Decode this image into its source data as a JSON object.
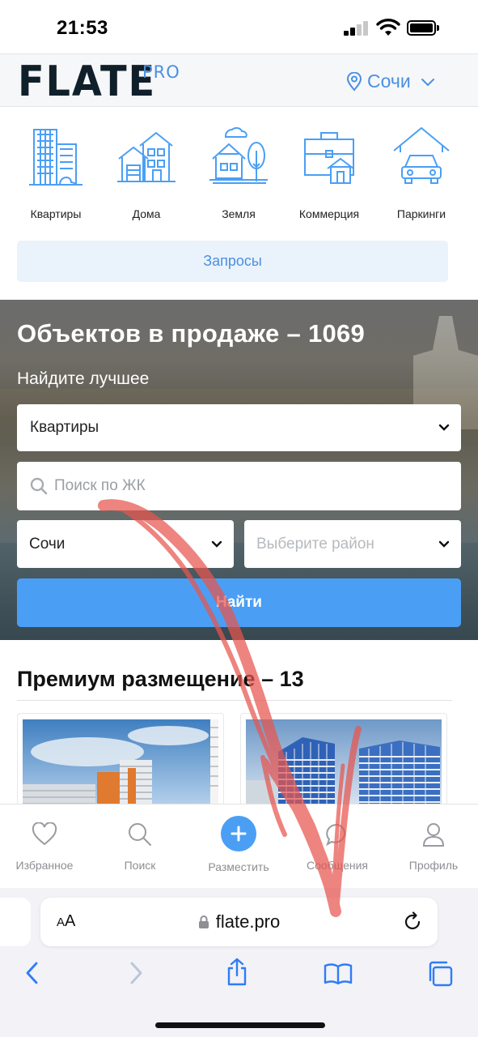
{
  "status_bar": {
    "time": "21:53"
  },
  "header": {
    "logo": "FLATE",
    "logo_badge": "PRO",
    "city": "Сочи"
  },
  "categories": [
    {
      "label": "Квартиры",
      "icon": "apartments-icon"
    },
    {
      "label": "Дома",
      "icon": "house-icon"
    },
    {
      "label": "Земля",
      "icon": "land-icon"
    },
    {
      "label": "Коммерция",
      "icon": "commercial-icon"
    },
    {
      "label": "Паркинги",
      "icon": "parking-icon"
    }
  ],
  "requests_label": "Запросы",
  "hero": {
    "title": "Объектов в продаже – 1069",
    "subtitle": "Найдите лучшее",
    "property_type": "Квартиры",
    "search_placeholder": "Поиск по ЖК",
    "city": "Сочи",
    "district_placeholder": "Выберите район",
    "search_button": "Найти"
  },
  "premium": {
    "title": "Премиум размещение – 13"
  },
  "tabbar": [
    {
      "label": "Избранное",
      "icon": "heart-icon"
    },
    {
      "label": "Поиск",
      "icon": "search-icon"
    },
    {
      "label": "Разместить",
      "icon": "plus-icon"
    },
    {
      "label": "Сообщения",
      "icon": "chat-icon"
    },
    {
      "label": "Профиль",
      "icon": "profile-icon"
    }
  ],
  "browser": {
    "text_size_label": "AA",
    "url": "flate.pro"
  },
  "colors": {
    "accent": "#4a9ff5",
    "brand_blue": "#4a90e2",
    "logo_dark": "#10202b",
    "annotation": "#e8554e"
  }
}
